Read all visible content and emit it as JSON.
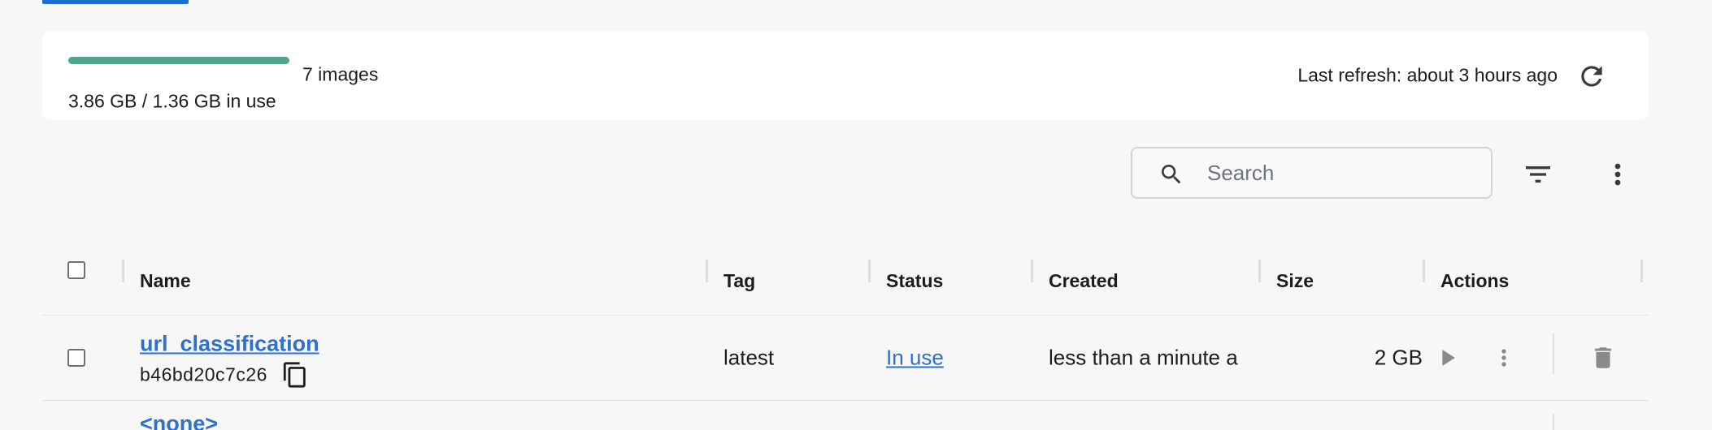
{
  "usage": {
    "text": "3.86 GB / 1.36 GB in use",
    "fill_fraction": 1.0,
    "count": "7 images",
    "refresh": "Last refresh: about 3 hours ago"
  },
  "search": {
    "placeholder": "Search",
    "value": ""
  },
  "table": {
    "columns": {
      "name": "Name",
      "tag": "Tag",
      "status": "Status",
      "created": "Created",
      "size": "Size",
      "actions": "Actions"
    },
    "rows": [
      {
        "name": "url_classification",
        "id": "b46bd20c7c26",
        "tag": "latest",
        "status": "In use",
        "created": "less than a minute a",
        "size": "2 GB"
      }
    ],
    "next_row_name": "<none>"
  },
  "icons": {
    "refresh": "refresh-icon",
    "search": "search-icon",
    "filter": "filter-icon",
    "more": "more-vert-icon",
    "copy": "copy-icon",
    "run": "play-icon",
    "row_more": "more-vert-icon",
    "delete": "trash-icon"
  },
  "colors": {
    "accent": "#1f6fd1",
    "link": "#2f6fce",
    "usage_fill": "#4fa58f"
  }
}
